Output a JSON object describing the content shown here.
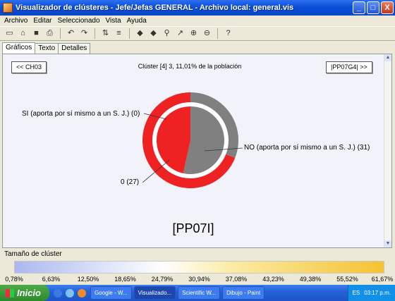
{
  "window": {
    "title": "Visualizador de clústeres - Jefe/Jefas GENERAL - Archivo local: general.vis",
    "minimize": "_",
    "maximize": "□",
    "close": "X"
  },
  "menu": [
    "Archivo",
    "Editar",
    "Seleccionado",
    "Vista",
    "Ayuda"
  ],
  "toolbar_icons": [
    "new-icon",
    "open-icon",
    "save-icon",
    "print-icon",
    "undo-icon",
    "redo-icon",
    "sort-icon",
    "filter-icon",
    "back-icon",
    "forward-icon",
    "find-icon",
    "chart-icon",
    "zoom-in-icon",
    "zoom-out-icon",
    "help-icon"
  ],
  "tabs": [
    "Gráficos",
    "Texto",
    "Detalles"
  ],
  "active_tab": "Gráficos",
  "nav": {
    "prev": "<< CH03",
    "next": "|PP07G4| >>"
  },
  "cluster_info": "Clúster [4] 3, 11,01% de la población",
  "chart_data": {
    "type": "pie",
    "title": "[PP07I]",
    "inner_ring": [
      {
        "label": "SI (aporta por sí mismo a un S. J.) (0)",
        "value": 0,
        "color": "#d9d9d9"
      },
      {
        "label": "NO (aporta por sí mismo a un S. J.) (31)",
        "value": 31,
        "color": "#808080"
      },
      {
        "label": "0 (27)",
        "value": 27,
        "color": "#ee2222"
      }
    ],
    "outer_ring": [
      {
        "label": "NO",
        "value": 31,
        "color": "#808080"
      },
      {
        "label": "0",
        "value": 69,
        "color": "#ee2222"
      }
    ]
  },
  "legend": {
    "title": "Tamaño de clúster",
    "ticks": [
      "0,78%",
      "6,63%",
      "12,50%",
      "18,65%",
      "24,79%",
      "30,94%",
      "37,08%",
      "43,23%",
      "49,38%",
      "55,52%",
      "61,67%"
    ]
  },
  "taskbar": {
    "start": "Inicio",
    "tasks": [
      "Google - W...",
      "Visualizado...",
      "Scientific W...",
      "Dibujo - Paint"
    ],
    "lang": "ES",
    "clock": "03:17 p.m."
  }
}
